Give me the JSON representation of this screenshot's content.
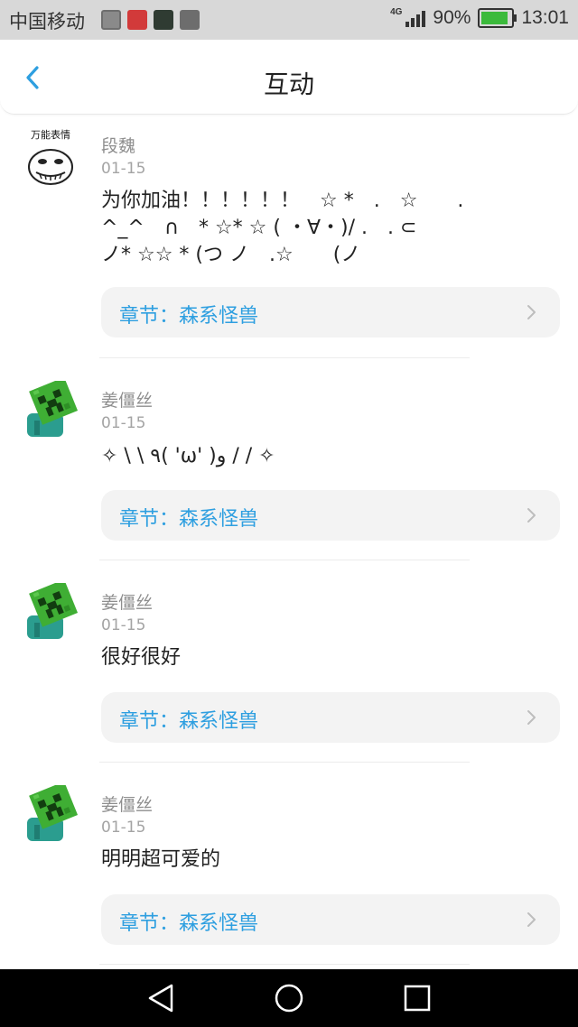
{
  "status_bar": {
    "carrier": "中国移动",
    "network": "4G",
    "battery": "90%",
    "battery_level": 0.9,
    "time": "13:01",
    "app_icons": [
      "gallery-icon",
      "app-icon-red",
      "reverse-app-icon",
      "game-app-icon"
    ]
  },
  "header": {
    "title": "互动",
    "back_icon": "chevron-left-icon",
    "accent_color": "#2e9fe0"
  },
  "items": [
    {
      "avatar": "万能表情",
      "name": "段魏",
      "date": "01-15",
      "content": "为你加油！！！！！！　☆ *　.　☆　　.\n^_^　∩　* ☆* ☆ ( ・∀・)/ .　. ⊂\nノ* ☆☆ * (つ ノ　.☆　　(ノ",
      "chapter": "章节：森系怪兽"
    },
    {
      "avatar": "creeper",
      "name": "姜僵丝",
      "date": "01-15",
      "content": "✧ \\ \\ ٩( 'ω' )و / / ✧",
      "chapter": "章节：森系怪兽"
    },
    {
      "avatar": "creeper",
      "name": "姜僵丝",
      "date": "01-15",
      "content": "很好很好",
      "chapter": "章节：森系怪兽"
    },
    {
      "avatar": "creeper",
      "name": "姜僵丝",
      "date": "01-15",
      "content": "明明超可爱的",
      "chapter": "章节：森系怪兽"
    }
  ],
  "system_nav": {
    "back": "triangle-back-icon",
    "home": "circle-home-icon",
    "recents": "square-recents-icon"
  }
}
